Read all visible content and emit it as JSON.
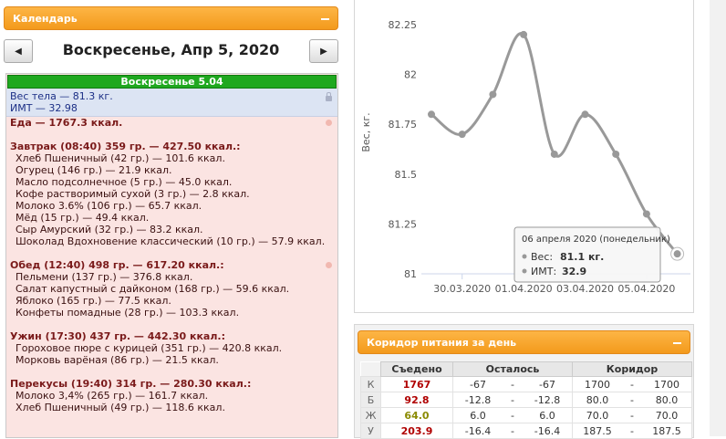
{
  "calendar": {
    "title": "Календарь",
    "date": "Воскресенье, Апр 5, 2020",
    "prev": "◀",
    "next": "▶"
  },
  "day": {
    "header": "Воскресенье 5.04",
    "weight": "Вес тела — 81.3 кг.",
    "bmi": "ИМТ — 32.98",
    "food_total": "Еда — 1767.3 ккал.",
    "meals": [
      {
        "title": "Завтрак (08:40) 359 гр. — 427.50 ккал.:",
        "items": [
          "Хлеб Пшеничный (42 гр.) — 101.6 ккал.",
          "Огурец (146 гр.) — 21.9 ккал.",
          "Масло подсолнечное (5 гр.) — 45.0 ккал.",
          "Кофе растворимый сухой (3 гр.) — 2.8 ккал.",
          "Молоко 3.6% (106 гр.) — 65.7 ккал.",
          "Мёд (15 гр.) — 49.4 ккал.",
          "Сыр Амурский (32 гр.) — 83.2 ккал.",
          "Шоколад Вдохновение классический (10 гр.) — 57.9 ккал."
        ]
      },
      {
        "title": "Обед (12:40) 498 гр. — 617.20 ккал.:",
        "items": [
          "Пельмени (137 гр.) — 376.8 ккал.",
          "Салат капустный с дайконом (168 гр.) — 59.6 ккал.",
          "Яблоко (165 гр.) — 77.5 ккал.",
          "Конфеты помадные (28 гр.) — 103.3 ккал."
        ]
      },
      {
        "title": "Ужин (17:30) 437 гр. — 442.30 ккал.:",
        "items": [
          "Гороховое пюре с курицей (351 гр.) — 420.8 ккал.",
          "Морковь варёная (86 гр.) — 21.5 ккал."
        ]
      },
      {
        "title": "Перекусы (19:40) 314 гр. — 280.30 ккал.:",
        "items": [
          "Молоко 3,4% (265 гр.) — 161.7 ккал.",
          "Хлеб Пшеничный (49 гр.) — 118.6 ккал."
        ]
      }
    ]
  },
  "chart_data": {
    "type": "line",
    "ylabel": "Вес, кг.",
    "ylim": [
      81,
      82.25
    ],
    "yticks": [
      "82.25",
      "82",
      "81.75",
      "81.5",
      "81.25",
      "81"
    ],
    "xticks": [
      "30.03.2020",
      "01.04.2020",
      "03.04.2020",
      "05.04.2020"
    ],
    "series": [
      {
        "values": [
          81.8,
          81.7,
          81.9,
          82.2,
          81.6,
          81.8,
          81.6,
          81.3,
          81.1
        ]
      }
    ],
    "color": "#999999",
    "tooltip": {
      "date": "06 апреля 2020 (понедельник)",
      "weight_label": "Вес:",
      "weight_value": "81.1 кг.",
      "bmi_label": "ИМТ:",
      "bmi_value": "32.9"
    }
  },
  "corridor": {
    "title": "Коридор питания за день",
    "headers": [
      "Съедено",
      "Осталось",
      "Коридор"
    ],
    "rows": [
      {
        "label": "К",
        "eaten": "1767",
        "eaten_color": "#b00000",
        "rem_a": "-67",
        "dash1": "-",
        "rem_b": "-67",
        "cor_a": "1700",
        "dash2": "-",
        "cor_b": "1700"
      },
      {
        "label": "Б",
        "eaten": "92.8",
        "eaten_color": "#b00000",
        "rem_a": "-12.8",
        "dash1": "-",
        "rem_b": "-12.8",
        "cor_a": "80.0",
        "dash2": "-",
        "cor_b": "80.0"
      },
      {
        "label": "Ж",
        "eaten": "64.0",
        "eaten_color": "#8a8a00",
        "rem_a": "6.0",
        "dash1": "-",
        "rem_b": "6.0",
        "cor_a": "70.0",
        "dash2": "-",
        "cor_b": "70.0"
      },
      {
        "label": "У",
        "eaten": "203.9",
        "eaten_color": "#b00000",
        "rem_a": "-16.4",
        "dash1": "-",
        "rem_b": "-16.4",
        "cor_a": "187.5",
        "dash2": "-",
        "cor_b": "187.5"
      }
    ]
  }
}
